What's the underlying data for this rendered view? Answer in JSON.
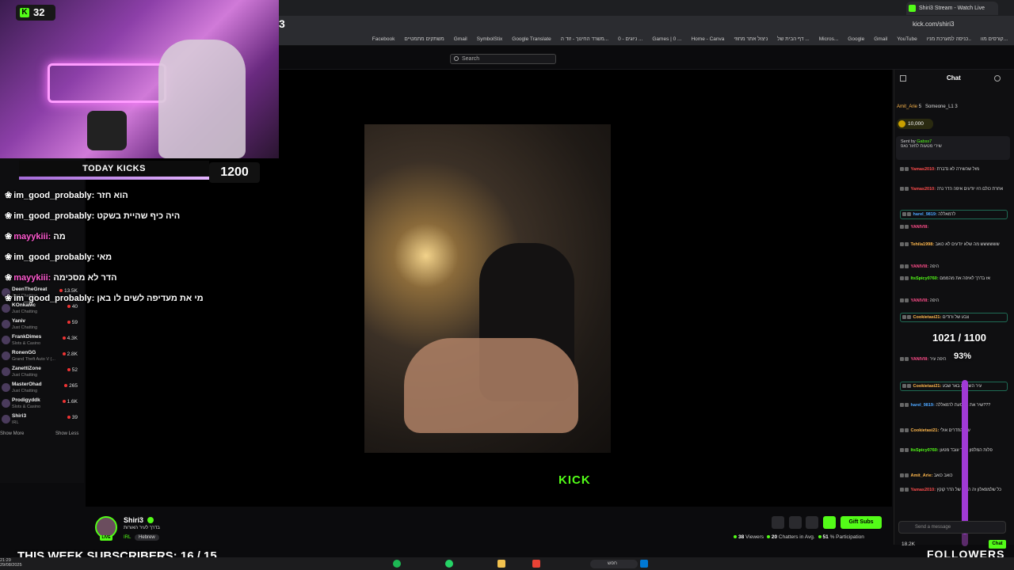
{
  "browser": {
    "tab_title": "Shiri3 Stream - Watch Live",
    "url": "kick.com/shiri3",
    "addr_prefix": "3",
    "bookmarks": [
      "Facebook",
      "משתקים מתמטיים",
      "Gmail",
      "SymbolStix",
      "Google Translate",
      "משרד החינוך - זוד ה...",
      "ניוגים - 0 ...",
      "Games | 0 ...",
      "Home - Canva",
      "ניצול אתר מחוזי",
      "דף הבית של ...",
      "Micros...",
      "Google",
      "Gmail",
      "YouTube",
      "כניסה למערכת מניו..",
      "קורסים מוו..."
    ]
  },
  "header": {
    "search_placeholder": "Search"
  },
  "overlay": {
    "kick_count": "32",
    "today_kicks_label": "TODAY KICKS",
    "today_kicks_value": "1200",
    "today_kicks_fill": 1.0,
    "chat": [
      {
        "user": "im_good_probably:",
        "text": "הוא חזר",
        "style": "white"
      },
      {
        "user": "im_good_probably:",
        "text": "היה כיף שהיית בשקט",
        "style": "white"
      },
      {
        "user": "mayykiii:",
        "text": "מה",
        "style": "pink"
      },
      {
        "user": "im_good_probably:",
        "text": "מאי",
        "style": "white"
      },
      {
        "user": "mayykiii:",
        "text": "הדר לא מסכימה",
        "style": "pink"
      },
      {
        "user": "im_good_probably:",
        "text": "מי את מעדיפה לשים לו באן",
        "style": "white"
      }
    ],
    "subs_banner": "THIS WEEK SUBSCRIBERS: 16 / 15",
    "followers_label": "FOLLOWERS",
    "goal_text": "1021 / 1100",
    "goal_pct": "93%",
    "goal_fraction": 0.93
  },
  "sidebar": {
    "items": [
      {
        "name": "DeenTheGreat",
        "category": "Just Chatting",
        "count": "13.5K"
      },
      {
        "name": "KOnkaMc",
        "category": "Just Chatting",
        "count": "40"
      },
      {
        "name": "Yaniv",
        "category": "Just Chatting",
        "count": "59"
      },
      {
        "name": "FrankDimes",
        "category": "Slots & Casino",
        "count": "4.3K"
      },
      {
        "name": "RonenGG",
        "category": "Grand Theft Auto V (...",
        "count": "2.8K"
      },
      {
        "name": "ZanettiZone",
        "category": "Just Chatting",
        "count": "52"
      },
      {
        "name": "MasterOhad",
        "category": "Just Chatting",
        "count": "265"
      },
      {
        "name": "Prodigyddk",
        "category": "Slots & Casino",
        "count": "1.6K"
      },
      {
        "name": "Shiri3",
        "category": "IRL",
        "count": "39"
      }
    ],
    "show_more": "Show More",
    "show_less": "Show Less"
  },
  "player": {
    "watermark": "KICK"
  },
  "channel": {
    "name": "Shiri3",
    "live": "LIVE",
    "title": "בדרך לעיר האורות",
    "category": "IRL",
    "language": "Hebrew",
    "gift_label": "Gift Subs",
    "viewers": "38",
    "viewers_label": "Viewers",
    "chatters": "20",
    "chatters_label": "Chatters in Avg.",
    "participation": "51",
    "participation_label": "% Participation"
  },
  "chat": {
    "title": "Chat",
    "gifters": [
      {
        "name": "Amit_Arie",
        "count": "5"
      },
      {
        "name": "Someone_L1",
        "count": "3"
      }
    ],
    "coins": "10,000",
    "pinned_sender_prefix": "Sent by",
    "pinned_sender": "Gabss7",
    "pinned_text": "שירי מטעות לחזור נאפ",
    "messages": [
      {
        "user": "Yamas2010:",
        "text": "מזל שהשירה לא נדברת",
        "color": "#ff4d4d"
      },
      {
        "user": "Yamas2010:",
        "text": "אחרת כולם היו יודעים איפה הדר נרה",
        "color": "#ff4d4d"
      },
      {
        "user": "harel_9819:",
        "text": "לרמאללה",
        "color": "#4da6ff"
      },
      {
        "user": "YANIVIII:",
        "text": "",
        "color": "#ff4d8a"
      },
      {
        "user": "Tehila1998:",
        "text": "שששששש מה שלא יודעים לא כואב",
        "color": "#ffb84d"
      },
      {
        "user": "YANIVIII:",
        "text": "היפה",
        "color": "#ff4d8a"
      },
      {
        "user": "ItsSpicy0760:",
        "text": "אז בדרך לאיפה את מהממם",
        "color": "#53fc18"
      },
      {
        "user": "YANIVIII:",
        "text": "היפה",
        "color": "#ff4d8a"
      },
      {
        "user": "Cookietasi21:",
        "text": "צבע של ורודים",
        "color": "#ffb84d"
      },
      {
        "user": "YANIVIII:",
        "text": "היפה עיר",
        "color": "#ff4d8a"
      },
      {
        "user": "Cookietasi21:",
        "text": "עיר השורות באר שבע",
        "color": "#ffb84d"
      },
      {
        "user": "harel_9819:",
        "text": "שיר את הנוסעת לרמאללה???",
        "color": "#4da6ff"
      },
      {
        "user": "Cookietasi21:",
        "text": "עיר החדרים אולי",
        "color": "#ffb84d"
      },
      {
        "user": "ItsSpicy0760:",
        "text": "פלות המלפון שלך עובד מטען",
        "color": "#53fc18"
      },
      {
        "user": "Amit_Arie:",
        "text": "כואב כואב",
        "color": "#ffb84d"
      },
      {
        "user": "Yamas2010:",
        "text": "כל שלמפאלון זה הולא של הדר קוקץ",
        "color": "#ff4d4d"
      }
    ],
    "input_placeholder": "Send a message",
    "send_label": "Chat",
    "viewer_count": "18.2K"
  },
  "taskbar": {
    "time": "21:29",
    "date": "29/08/2025",
    "search": "חפש"
  }
}
